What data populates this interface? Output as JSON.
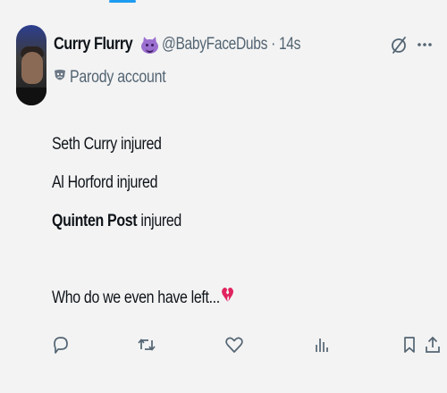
{
  "tweet": {
    "display_name": "Curry Flurry",
    "name_emoji_icon": "smiling-devil-emoji",
    "handle": "@BabyFaceDubs",
    "separator": "·",
    "time": "14s",
    "parody_label": "Parody account",
    "parody_icon": "theater-masks-icon",
    "lines": [
      {
        "text": "Seth Curry injured"
      },
      {
        "text": "Al Horford injured"
      },
      {
        "bold": "Quinten Post",
        "text": " injured"
      },
      {
        "text": ""
      },
      {
        "text": "Who do we even have left..."
      }
    ],
    "end_emoji_icon": "broken-heart-emoji"
  },
  "header_icons": [
    "grok-icon",
    "more-icon"
  ],
  "actions": [
    "reply-icon",
    "retweet-icon",
    "like-icon",
    "views-icon",
    "bookmark-icon",
    "share-icon"
  ],
  "colors": {
    "background": "#f3f3f4",
    "text": "#0f1419",
    "secondary": "#536471",
    "accent": "#1d9bf0",
    "broken_heart": "#e0245e"
  }
}
